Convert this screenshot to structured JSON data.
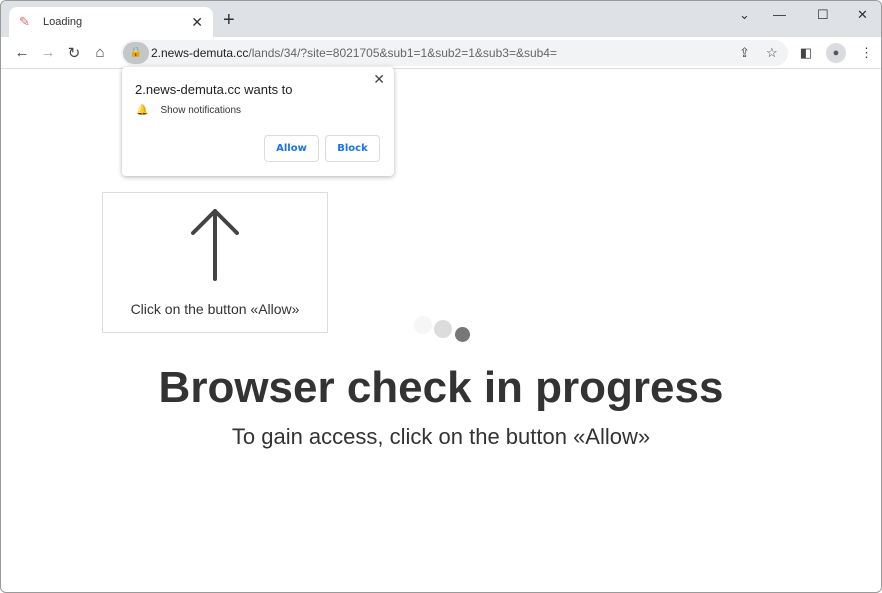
{
  "tab": {
    "title": "Loading",
    "favicon": "megaphone-icon"
  },
  "address": {
    "host": "2.news-demuta.cc",
    "path": "/lands/34/?site=8021705&sub1=1&sub2=1&sub3=&sub4="
  },
  "popup": {
    "title": "2.news-demuta.cc wants to",
    "permission": "Show notifications",
    "allow": "Allow",
    "block": "Block"
  },
  "hint": {
    "text": "Click on the button «Allow»"
  },
  "main": {
    "heading": "Browser check in progress",
    "subheading": "To gain access, click on the button «Allow»"
  }
}
